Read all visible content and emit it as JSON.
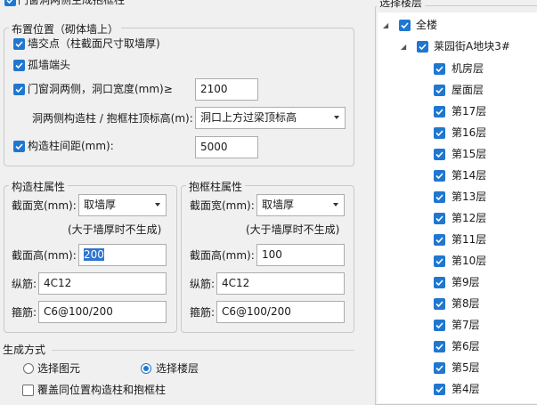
{
  "top_option": {
    "label": "门窗洞两侧生成抱框柱",
    "checked": true
  },
  "placement": {
    "title": "布置位置（砌体墙上）",
    "wall_intersection": {
      "label": "墙交点（柱截面尺寸取墙厚)",
      "checked": true
    },
    "wall_end": {
      "label": "孤墙端头",
      "checked": true
    },
    "door_window_sides": {
      "label": "门窗洞两侧，洞口宽度(mm)≥",
      "checked": true,
      "value": "2100"
    },
    "top_elevation": {
      "label": "洞两侧构造柱 / 抱框柱顶标高(m):",
      "value": "洞口上方过梁顶标高"
    },
    "spacing": {
      "label": "构造柱间距(mm):",
      "checked": true,
      "value": "5000"
    }
  },
  "column_props": {
    "title": "构造柱属性",
    "width_label": "截面宽(mm):",
    "width_value": "取墙厚",
    "note": "(大于墙厚时不生成)",
    "height_label": "截面高(mm):",
    "height_value": "200",
    "long_rebar_label": "纵筋:",
    "long_rebar_value": "4C12",
    "stirrup_label": "箍筋:",
    "stirrup_value": "C6@100/200"
  },
  "frame_props": {
    "title": "抱框柱属性",
    "width_label": "截面宽(mm):",
    "width_value": "取墙厚",
    "note": "(大于墙厚时不生成)",
    "height_label": "截面高(mm):",
    "height_value": "100",
    "long_rebar_label": "纵筋:",
    "long_rebar_value": "4C12",
    "stirrup_label": "箍筋:",
    "stirrup_value": "C6@100/200"
  },
  "generation": {
    "title": "生成方式",
    "option_elements": {
      "label": "选择图元",
      "selected": false
    },
    "option_floors": {
      "label": "选择楼层",
      "selected": true
    },
    "overwrite": {
      "label": "覆盖同位置构造柱和抱框柱",
      "checked": false
    }
  },
  "floors": {
    "title": "选择楼层",
    "all_label": "全楼",
    "building_label": "莱园街A地块3#",
    "items": [
      "机房层",
      "屋面层",
      "第17层",
      "第16层",
      "第15层",
      "第14层",
      "第13层",
      "第12层",
      "第11层",
      "第10层",
      "第9层",
      "第8层",
      "第7层",
      "第6层",
      "第5层",
      "第4层"
    ]
  },
  "colors": {
    "accent": "#1f77d0",
    "selection": "#3074d0"
  }
}
